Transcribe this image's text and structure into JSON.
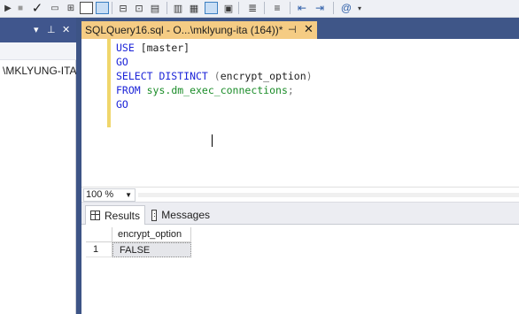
{
  "document_tab": {
    "title": "SQLQuery16.sql - O...\\mklyung-ita (164))*",
    "pin_icon": "pin-icon",
    "close_icon": "close-icon"
  },
  "object_explorer": {
    "header_icons": [
      "dropdown-icon",
      "pin-icon",
      "close-icon"
    ],
    "node_label": "\\MKLYUNG-ITA"
  },
  "editor": {
    "lines": [
      {
        "tokens": [
          {
            "t": "USE ",
            "c": "kw"
          },
          {
            "t": "[master]",
            "c": "ident"
          }
        ]
      },
      {
        "tokens": [
          {
            "t": "GO",
            "c": "kw"
          }
        ]
      },
      {
        "tokens": [
          {
            "t": "SELECT DISTINCT ",
            "c": "kw"
          },
          {
            "t": "(",
            "c": "gray"
          },
          {
            "t": "encrypt_option",
            "c": "ident"
          },
          {
            "t": ")",
            "c": "gray"
          }
        ]
      },
      {
        "tokens": [
          {
            "t": "FROM ",
            "c": "kw"
          },
          {
            "t": "sys.dm_exec_connections",
            "c": "green"
          },
          {
            "t": ";",
            "c": "gray"
          }
        ]
      },
      {
        "tokens": [
          {
            "t": "GO",
            "c": "kw"
          }
        ]
      }
    ]
  },
  "zoom": {
    "value": "100 %"
  },
  "results_tabs": {
    "results": "Results",
    "messages": "Messages"
  },
  "results_grid": {
    "columns": [
      "encrypt_option"
    ],
    "rows": [
      {
        "num": "1",
        "values": [
          "FALSE"
        ]
      }
    ]
  },
  "colors": {
    "tab_active": "#f5cc84",
    "chrome_dark": "#3f5688",
    "keyword": "#1c24d8",
    "sys_object": "#1a8c28"
  }
}
